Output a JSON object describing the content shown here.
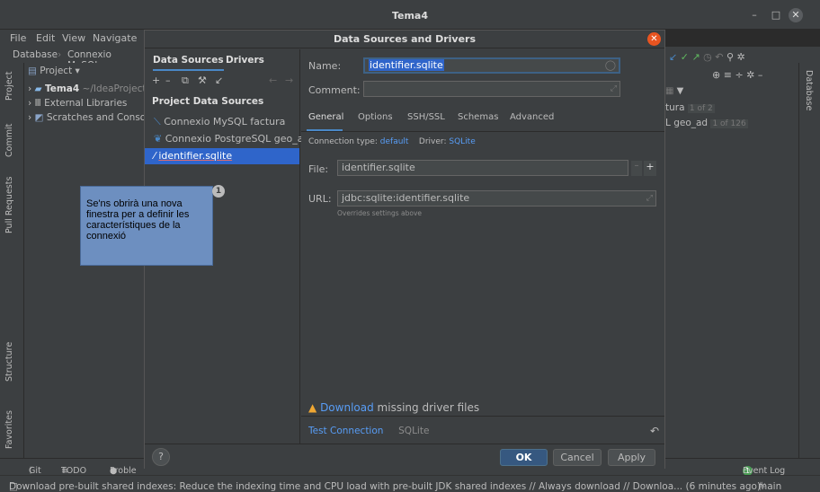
{
  "window": {
    "title": "Tema4",
    "minimize": "–",
    "maximize": "□",
    "close": "✕"
  },
  "menu": {
    "file": "File",
    "edit": "Edit",
    "view": "View",
    "navigate": "Navigate"
  },
  "breadcrumb": {
    "root": "Database",
    "item": "Connexio MySQL"
  },
  "left_tabs": {
    "project": "Project",
    "commit": "Commit",
    "pull_requests": "Pull Requests",
    "structure": "Structure",
    "favorites": "Favorites"
  },
  "project_panel": {
    "header": "Project",
    "items": [
      {
        "name": "Tema4",
        "path": "~/IdeaProject"
      },
      {
        "name": "External Libraries"
      },
      {
        "name": "Scratches and Conso"
      }
    ]
  },
  "right_panel": {
    "tab": "Database",
    "rows": [
      {
        "label": "tura",
        "badge": "1 of 2"
      },
      {
        "label": "L geo_ad",
        "badge": "1 of 126"
      }
    ]
  },
  "dialog": {
    "title": "Data Sources and Drivers",
    "tabs": {
      "data_sources": "Data Sources",
      "drivers": "Drivers"
    },
    "section_header": "Project Data Sources",
    "sources": [
      {
        "name": "Connexio MySQL factura"
      },
      {
        "name": "Connexio PostgreSQL geo_ad"
      },
      {
        "name": "identifier.sqlite"
      }
    ],
    "name_label": "Name:",
    "name_value": "identifier.sqlite",
    "comment_label": "Comment:",
    "subtabs": [
      "General",
      "Options",
      "SSH/SSL",
      "Schemas",
      "Advanced"
    ],
    "connection_type_label": "Connection type:",
    "connection_type_value": "default",
    "driver_label": "Driver:",
    "driver_value": "SQLite",
    "file_label": "File:",
    "file_value": "identifier.sqlite",
    "url_label": "URL:",
    "url_value": "jdbc:sqlite:identifier.sqlite",
    "url_hint": "Overrides settings above",
    "download_link": "Download",
    "download_rest": "missing driver files",
    "test_connection": "Test Connection",
    "test_driver": "SQLite",
    "buttons": {
      "help": "?",
      "ok": "OK",
      "cancel": "Cancel",
      "apply": "Apply"
    }
  },
  "note": {
    "badge": "1",
    "text": "Se'ns obrirà una nova finestra per a definir les característiques de la connexió"
  },
  "bottom_toolbar": {
    "git": "Git",
    "todo": "TODO",
    "problems": "Proble",
    "event_log": "Event Log",
    "event_count": "1"
  },
  "status_bar": {
    "message": "Download pre-built shared indexes: Reduce the indexing time and CPU load with pre-built JDK shared indexes // Always download // Downloa... (6 minutes ago)",
    "branch": "main"
  },
  "colors": {
    "accent": "#2f65ca",
    "link": "#589df6",
    "note_bg": "#6d8fc0",
    "close_btn": "#e95420",
    "warning": "#f0a732"
  }
}
